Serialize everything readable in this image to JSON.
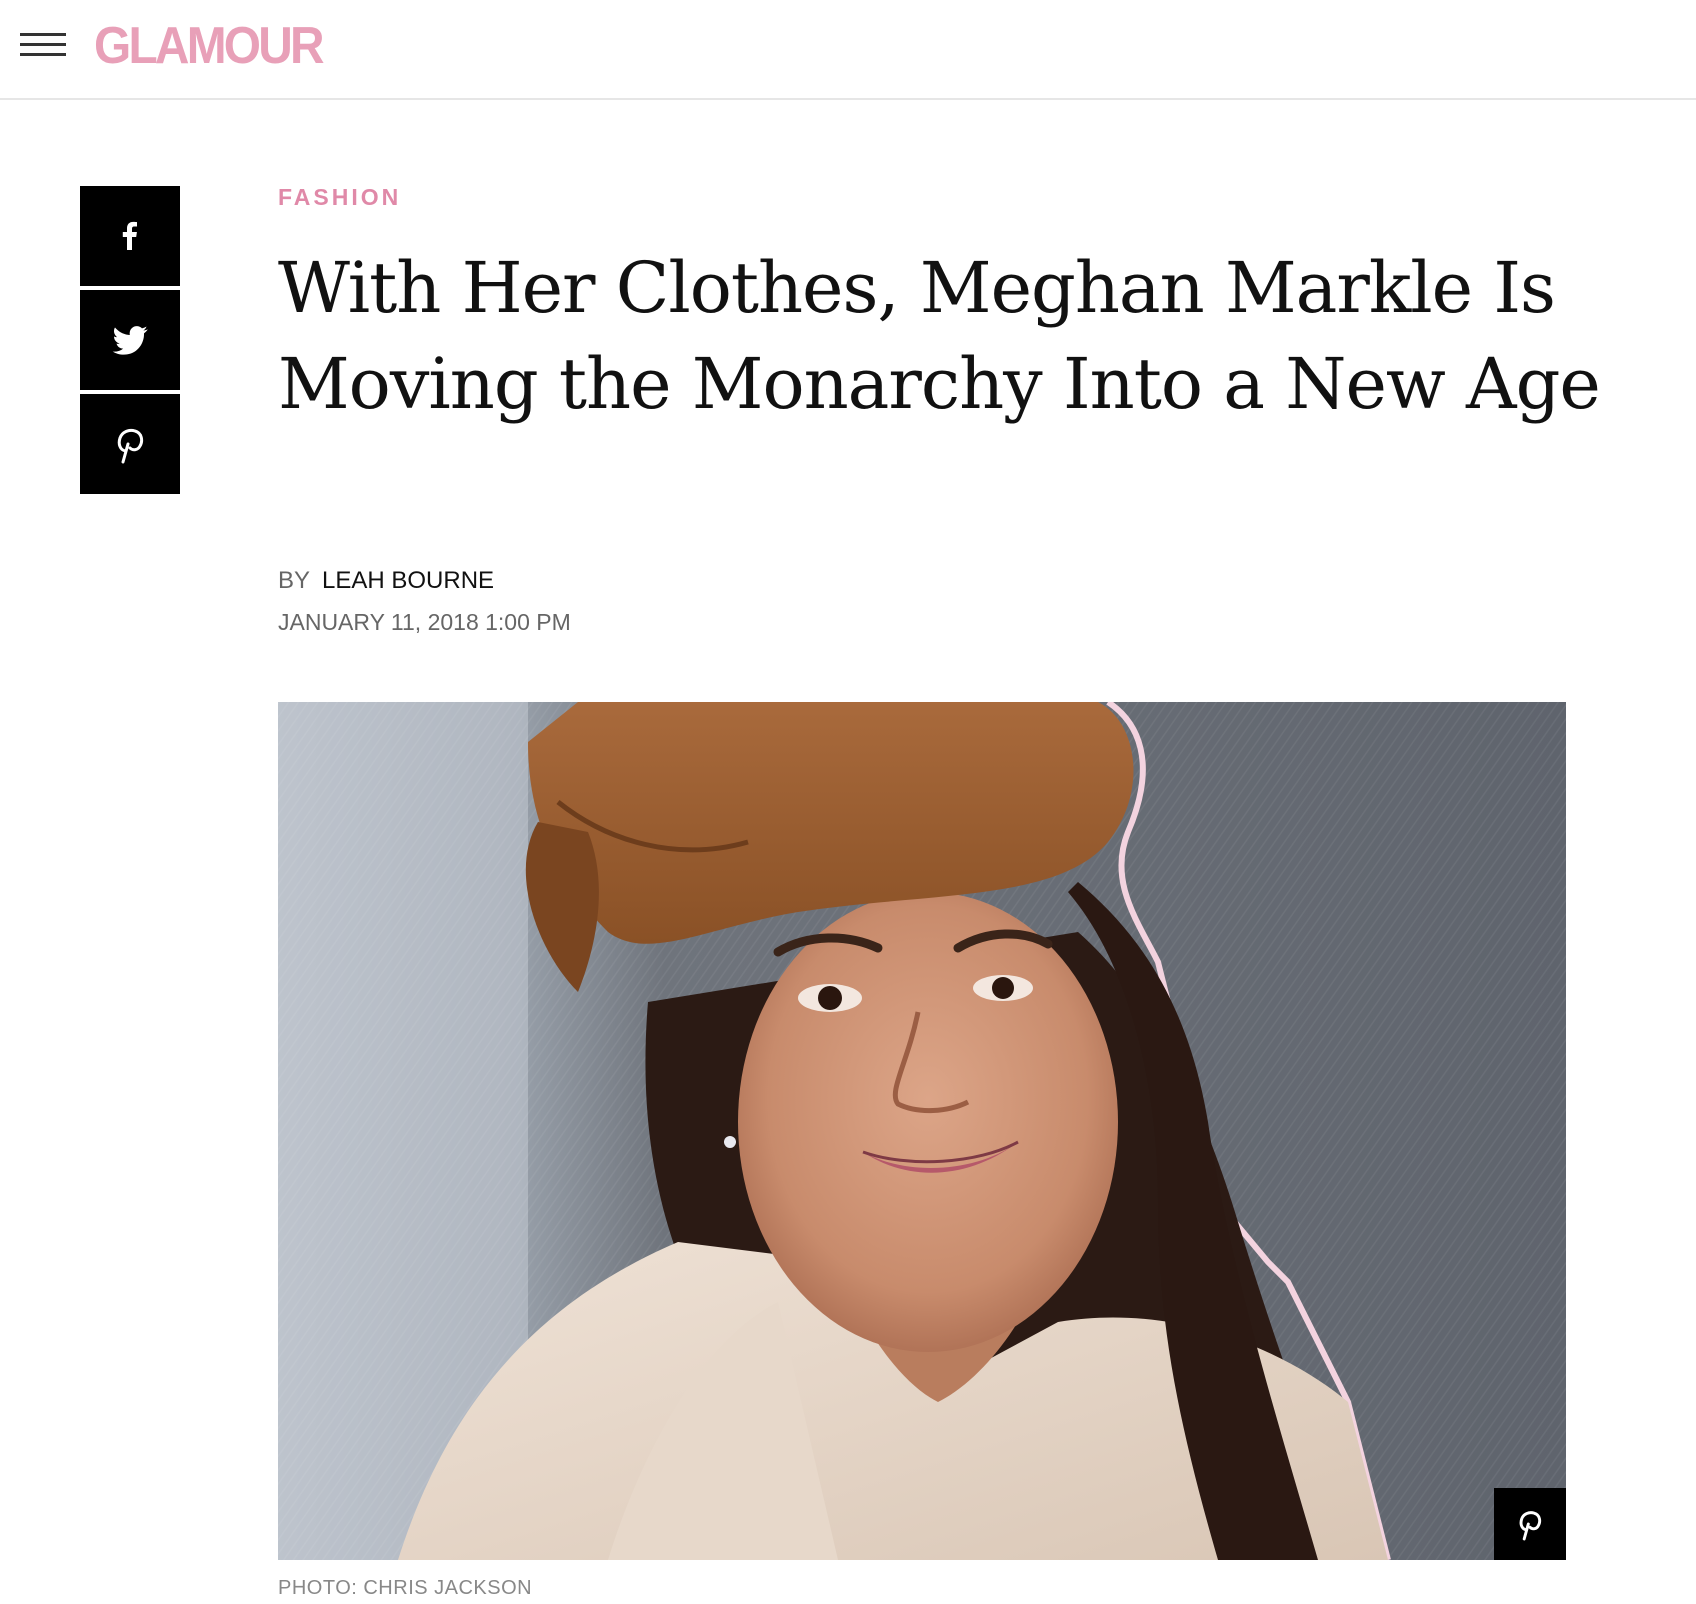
{
  "header": {
    "menu_icon": "hamburger-menu-icon",
    "logo_text": "GLAMOUR",
    "brand_color": "#e8a0b8"
  },
  "share": {
    "facebook_icon": "facebook-icon",
    "twitter_icon": "twitter-icon",
    "pinterest_icon": "pinterest-icon"
  },
  "article": {
    "category": "FASHION",
    "category_color": "#e089a8",
    "headline": "With Her Clothes, Meghan Markle Is Moving the Monarchy Into a New Age",
    "by_label": "BY",
    "author": "LEAH BOURNE",
    "date": "JANUARY 11, 2018 1:00 PM",
    "photo_credit": "PHOTO: CHRIS JACKSON",
    "image_pin_icon": "pinterest-icon"
  }
}
